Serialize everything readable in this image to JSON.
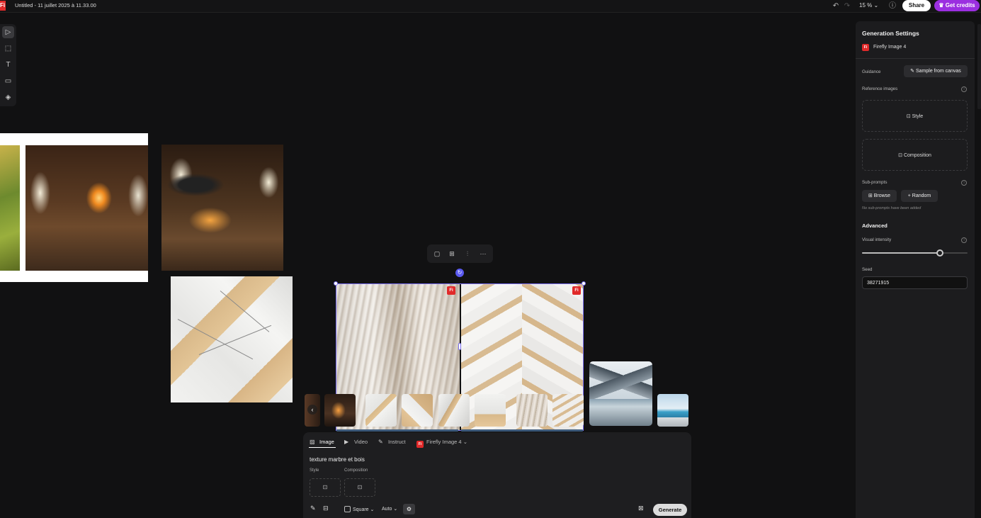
{
  "topbar": {
    "logo": "Fi",
    "title": "Untitled - 11 juillet 2025 à 11.33.00",
    "undo_icon": "undo-icon",
    "redo_icon": "redo-icon",
    "zoom": "15 %",
    "help_icon": "help-icon",
    "share_label": "Share",
    "credits_label": "Get credits"
  },
  "toolbar": {
    "tools": [
      "select-tool",
      "frame-tool",
      "text-tool",
      "shape-tool",
      "fill-tool"
    ],
    "glyphs": [
      "▷",
      "⬚",
      "T",
      "▭",
      "◈"
    ]
  },
  "canvas": {
    "badge": "Fi",
    "context_icons": [
      "▢",
      "⊞",
      "⫶",
      "···"
    ],
    "rotate_glyph": "↻",
    "strip_arrow": "‹"
  },
  "prompt": {
    "tabs": [
      {
        "label": "Image",
        "icon": "🖾"
      },
      {
        "label": "Video",
        "icon": "▶"
      },
      {
        "label": "Instruct",
        "icon": "✎"
      }
    ],
    "model_badge": "Fi",
    "model": "Firefly Image 4",
    "text": "texture marbre et bois",
    "style_label": "Style",
    "composition_label": "Composition",
    "ratio": "Square",
    "auto": "Auto",
    "generate_label": "Generate"
  },
  "panel": {
    "title": "Generation Settings",
    "model_badge": "Fi",
    "model": "Firefly Image 4",
    "guidance_label": "Guidance",
    "sample_label": "Sample from canvas",
    "reference_label": "Reference images",
    "style_label": "Style",
    "composition_label": "Composition",
    "subprompts_label": "Sub-prompts",
    "browse_label": "Browse",
    "random_label": "Random",
    "no_subprompts": "No sub-prompts have been added",
    "advanced_label": "Advanced",
    "visual_intensity_label": "Visual intensity",
    "visual_intensity_value": 0.74,
    "seed_label": "Seed",
    "seed_value": "38271915"
  }
}
